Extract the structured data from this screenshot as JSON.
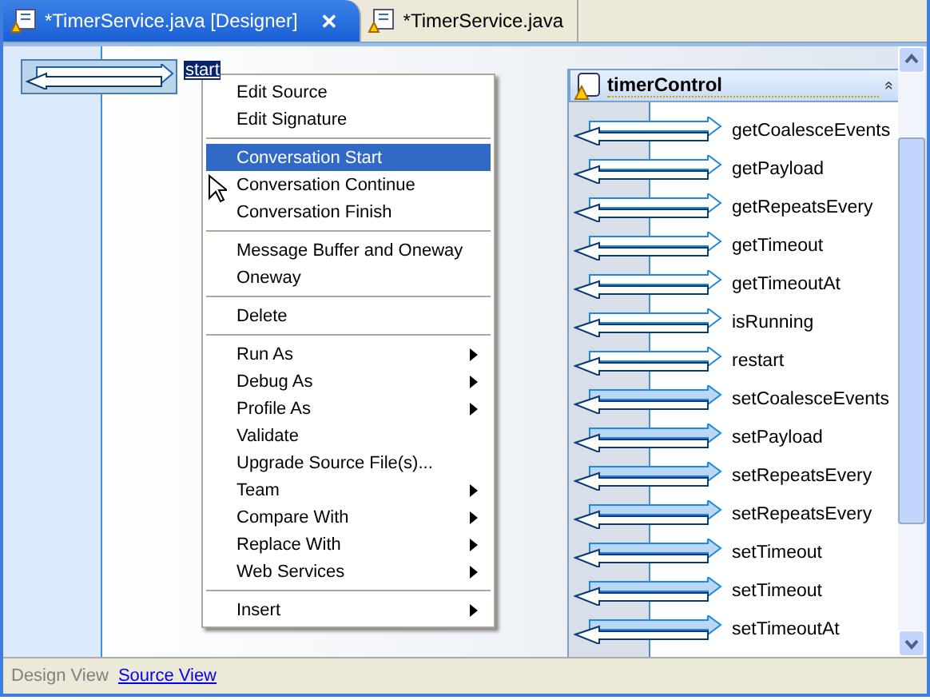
{
  "tabs": [
    {
      "label": "*TimerService.java [Designer]",
      "selected": true,
      "close": "✕"
    },
    {
      "label": "*TimerService.java",
      "selected": false
    }
  ],
  "canvas": {
    "start_node": {
      "label": "start",
      "selected": true
    },
    "control": {
      "title": "timerControl",
      "collapse": "«",
      "methods": [
        {
          "name": "getCoalesceEvents",
          "kind": "get"
        },
        {
          "name": "getPayload",
          "kind": "get"
        },
        {
          "name": "getRepeatsEvery",
          "kind": "get"
        },
        {
          "name": "getTimeout",
          "kind": "get"
        },
        {
          "name": "getTimeoutAt",
          "kind": "get"
        },
        {
          "name": "isRunning",
          "kind": "get"
        },
        {
          "name": "restart",
          "kind": "get"
        },
        {
          "name": "setCoalesceEvents",
          "kind": "set"
        },
        {
          "name": "setPayload",
          "kind": "set"
        },
        {
          "name": "setRepeatsEvery",
          "kind": "set"
        },
        {
          "name": "setRepeatsEvery",
          "kind": "set"
        },
        {
          "name": "setTimeout",
          "kind": "set"
        },
        {
          "name": "setTimeout",
          "kind": "set"
        },
        {
          "name": "setTimeoutAt",
          "kind": "set"
        }
      ]
    }
  },
  "context_menu": {
    "groups": [
      [
        {
          "label": "Edit Source",
          "submenu": false,
          "selected": false
        },
        {
          "label": "Edit Signature",
          "submenu": false,
          "selected": false
        }
      ],
      [
        {
          "label": "Conversation Start",
          "submenu": false,
          "selected": true
        },
        {
          "label": "Conversation Continue",
          "submenu": false,
          "selected": false
        },
        {
          "label": "Conversation Finish",
          "submenu": false,
          "selected": false
        }
      ],
      [
        {
          "label": "Message Buffer and Oneway",
          "submenu": false,
          "selected": false
        },
        {
          "label": "Oneway",
          "submenu": false,
          "selected": false
        }
      ],
      [
        {
          "label": "Delete",
          "submenu": false,
          "selected": false
        }
      ],
      [
        {
          "label": "Run As",
          "submenu": true,
          "selected": false
        },
        {
          "label": "Debug As",
          "submenu": true,
          "selected": false
        },
        {
          "label": "Profile As",
          "submenu": true,
          "selected": false
        },
        {
          "label": "Validate",
          "submenu": false,
          "selected": false
        },
        {
          "label": "Upgrade Source File(s)...",
          "submenu": false,
          "selected": false
        },
        {
          "label": "Team",
          "submenu": true,
          "selected": false
        },
        {
          "label": "Compare With",
          "submenu": true,
          "selected": false
        },
        {
          "label": "Replace With",
          "submenu": true,
          "selected": false
        },
        {
          "label": "Web Services",
          "submenu": true,
          "selected": false
        }
      ],
      [
        {
          "label": "Insert",
          "submenu": true,
          "selected": false
        }
      ]
    ]
  },
  "view_bar": [
    {
      "label": "Design View",
      "selected": true
    },
    {
      "label": "Source View",
      "selected": false
    }
  ]
}
